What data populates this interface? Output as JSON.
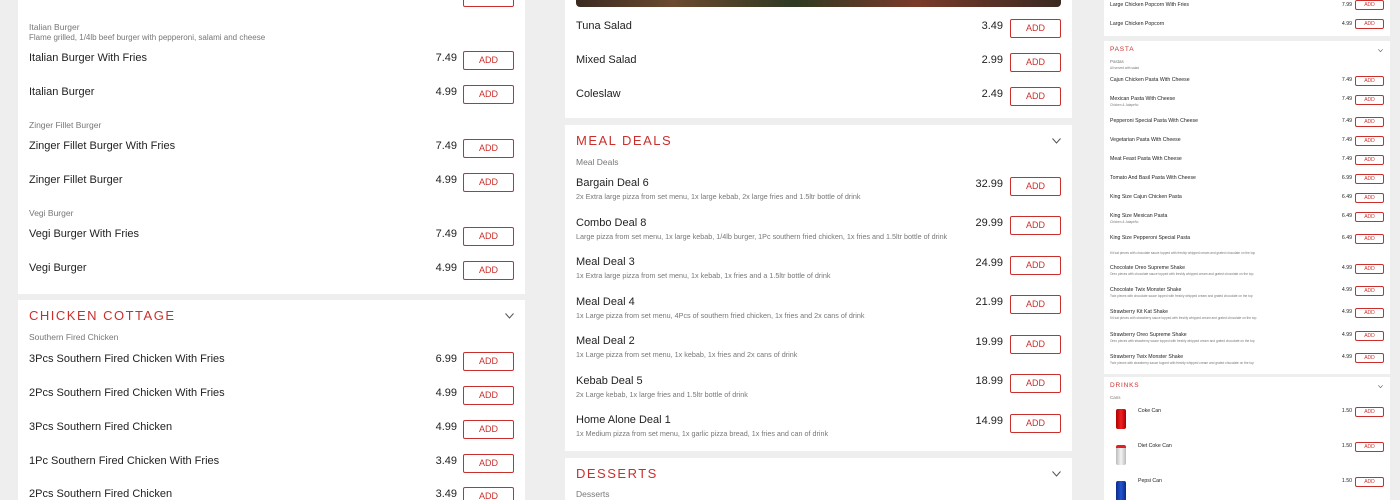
{
  "col1": {
    "top_card": {
      "category": "Italian Burger",
      "category_desc": "Flame grilled, 1/4lb beef burger with pepperoni, salami and cheese",
      "items": [
        {
          "name": "Italian Burger With Fries",
          "price": "7.49",
          "add": "ADD"
        },
        {
          "name": "Italian Burger",
          "price": "4.99",
          "add": "ADD"
        }
      ],
      "category2": "Zinger Fillet Burger",
      "items2": [
        {
          "name": "Zinger Fillet Burger With Fries",
          "price": "7.49",
          "add": "ADD"
        },
        {
          "name": "Zinger Fillet Burger",
          "price": "4.99",
          "add": "ADD"
        }
      ],
      "category3": "Vegi Burger",
      "items3": [
        {
          "name": "Vegi Burger With Fries",
          "price": "7.49",
          "add": "ADD"
        },
        {
          "name": "Vegi Burger",
          "price": "4.99",
          "add": "ADD"
        }
      ]
    },
    "chicken_section": {
      "title": "CHICKEN COTTAGE",
      "category": "Southern Fired Chicken",
      "items": [
        {
          "name": "3Pcs Southern Fired Chicken With Fries",
          "price": "6.99",
          "add": "ADD"
        },
        {
          "name": "2Pcs Southern Fired Chicken With Fries",
          "price": "4.99",
          "add": "ADD"
        },
        {
          "name": "3Pcs Southern Fired Chicken",
          "price": "4.99",
          "add": "ADD"
        },
        {
          "name": "1Pc Southern Fired Chicken With Fries",
          "price": "3.49",
          "add": "ADD"
        },
        {
          "name": "2Pcs Southern Fired Chicken",
          "price": "3.49",
          "add": "ADD"
        }
      ]
    }
  },
  "col2": {
    "salads": [
      {
        "name": "Tuna Salad",
        "price": "3.49",
        "add": "ADD"
      },
      {
        "name": "Mixed Salad",
        "price": "2.99",
        "add": "ADD"
      },
      {
        "name": "Coleslaw",
        "price": "2.49",
        "add": "ADD"
      }
    ],
    "meal_deals": {
      "title": "MEAL DEALS",
      "category": "Meal Deals",
      "items": [
        {
          "name": "Bargain Deal 6",
          "desc": "2x Extra large pizza from set menu, 1x large kebab, 2x large fries and 1.5ltr bottle of drink",
          "price": "32.99",
          "add": "ADD"
        },
        {
          "name": "Combo Deal 8",
          "desc": "Large pizza from set menu, 1x large kebab, 1/4lb burger, 1Pc southern fried chicken, 1x fries and 1.5ltr bottle of drink",
          "price": "29.99",
          "add": "ADD"
        },
        {
          "name": "Meal Deal 3",
          "desc": "1x Extra large pizza from set menu, 1x kebab, 1x fries and a 1.5ltr bottle of drink",
          "price": "24.99",
          "add": "ADD"
        },
        {
          "name": "Meal Deal 4",
          "desc": "1x Large pizza from set menu, 4Pcs of southern fried chicken, 1x fries and 2x cans of drink",
          "price": "21.99",
          "add": "ADD"
        },
        {
          "name": "Meal Deal 2",
          "desc": "1x Large pizza from set menu, 1x kebab, 1x fries and 2x cans of drink",
          "price": "19.99",
          "add": "ADD"
        },
        {
          "name": "Kebab Deal 5",
          "desc": "2x Large kebab, 1x large fries and 1.5ltr bottle of drink",
          "price": "18.99",
          "add": "ADD"
        },
        {
          "name": "Home Alone Deal 1",
          "desc": "1x Medium pizza from set menu, 1x garlic pizza bread, 1x fries and can of drink",
          "price": "14.99",
          "add": "ADD"
        }
      ]
    },
    "desserts": {
      "title": "DESSERTS",
      "category": "Desserts"
    }
  },
  "col3": {
    "top_items": [
      {
        "name": "Large Chicken Popcorn With Fries",
        "price": "7.99",
        "add": "ADD"
      },
      {
        "name": "Large Chicken Popcorn",
        "price": "4.99",
        "add": "ADD"
      }
    ],
    "pasta": {
      "title": "PASTA",
      "category": "Pastas",
      "category_desc": "All served with salad",
      "items": [
        {
          "name": "Cajun Chicken Pasta With Cheese",
          "desc": "",
          "price": "7.49",
          "add": "ADD"
        },
        {
          "name": "Mexican Pasta With Cheese",
          "desc": "Chicken & Jalapeño",
          "price": "7.49",
          "add": "ADD"
        },
        {
          "name": "Pepperoni Special Pasta With Cheese",
          "desc": "",
          "price": "7.49",
          "add": "ADD"
        },
        {
          "name": "Vegetarian Pasta With Cheese",
          "desc": "",
          "price": "7.49",
          "add": "ADD"
        },
        {
          "name": "Meat Feast Pasta With Cheese",
          "desc": "",
          "price": "7.49",
          "add": "ADD"
        },
        {
          "name": "Tomato And Basil Pasta With Cheese",
          "desc": "",
          "price": "6.99",
          "add": "ADD"
        },
        {
          "name": "King Size Cajun Chicken Pasta",
          "desc": "",
          "price": "6.49",
          "add": "ADD"
        },
        {
          "name": "King Size Mexican Pasta",
          "desc": "Chicken & Jalapeño",
          "price": "6.49",
          "add": "ADD"
        },
        {
          "name": "King Size Pepperoni Special Pasta",
          "desc": "",
          "price": "6.49",
          "add": "ADD"
        }
      ]
    },
    "shakes": [
      {
        "name": "Chocolate Oreo Supreme Shake",
        "desc": "Oreo pieces with chocolate sauce topped with freshly whipped cream and grated chocolate on the top",
        "price": "4.99",
        "add": "ADD"
      },
      {
        "name": "Chocolate Twix Monster Shake",
        "desc": "Twix pieces with chocolate sauce topped with freshly whipped cream and grated chocolate on the top",
        "price": "4.99",
        "add": "ADD"
      },
      {
        "name": "Strawberry Kit Kat Shake",
        "desc": "Kit kat pieces with strawberry sauce topped with freshly whipped cream and grated chocolate on the top",
        "price": "4.99",
        "add": "ADD"
      },
      {
        "name": "Strawberry Oreo Supreme Shake",
        "desc": "Oreo pieces with strawberry sauce topped with freshly whipped cream and grated chocolate on the top",
        "price": "4.99",
        "add": "ADD"
      },
      {
        "name": "Strawberry Twix Monster Shake",
        "desc": "Twix pieces with strawberry sauce topped with freshly whipped cream and grated chocolate on the top",
        "price": "4.99",
        "add": "ADD"
      }
    ],
    "shakes_partial_desc": "Kit kat pieces with chocolate sauce topped with freshly whipped cream and grated chocolate on the top",
    "drinks": {
      "title": "DRINKS",
      "category": "Cans",
      "items": [
        {
          "name": "Coke Can",
          "price": "1.50",
          "add": "ADD"
        },
        {
          "name": "Diet Coke Can",
          "price": "1.50",
          "add": "ADD"
        },
        {
          "name": "Pepsi Can",
          "price": "1.50",
          "add": "ADD"
        }
      ]
    }
  },
  "colors": {
    "accent": "#c9302c",
    "bg": "#eeeeee",
    "card": "#ffffff"
  }
}
